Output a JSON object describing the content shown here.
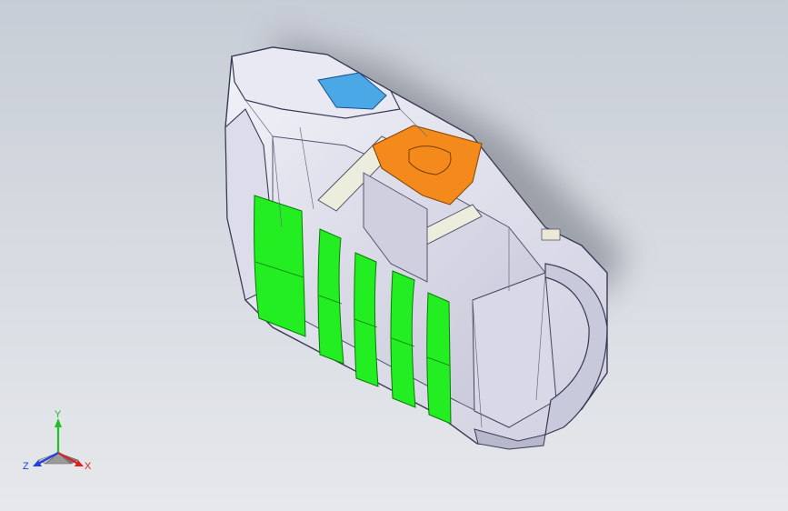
{
  "viewport": {
    "background_top": "#c7cdd6",
    "background_bottom": "#e6e8eb"
  },
  "model": {
    "body_color": "#e4e4ef",
    "edge_color": "#3a3a55",
    "highlight_green": "#22ee22",
    "highlight_orange": "#f58a1c",
    "highlight_blue": "#4aa8e6"
  },
  "triad": {
    "y_label": "Y",
    "z_label": "Z",
    "x_label": "X",
    "y_color": "#20c020",
    "x_color": "#e02020",
    "z_color": "#2040e0"
  }
}
